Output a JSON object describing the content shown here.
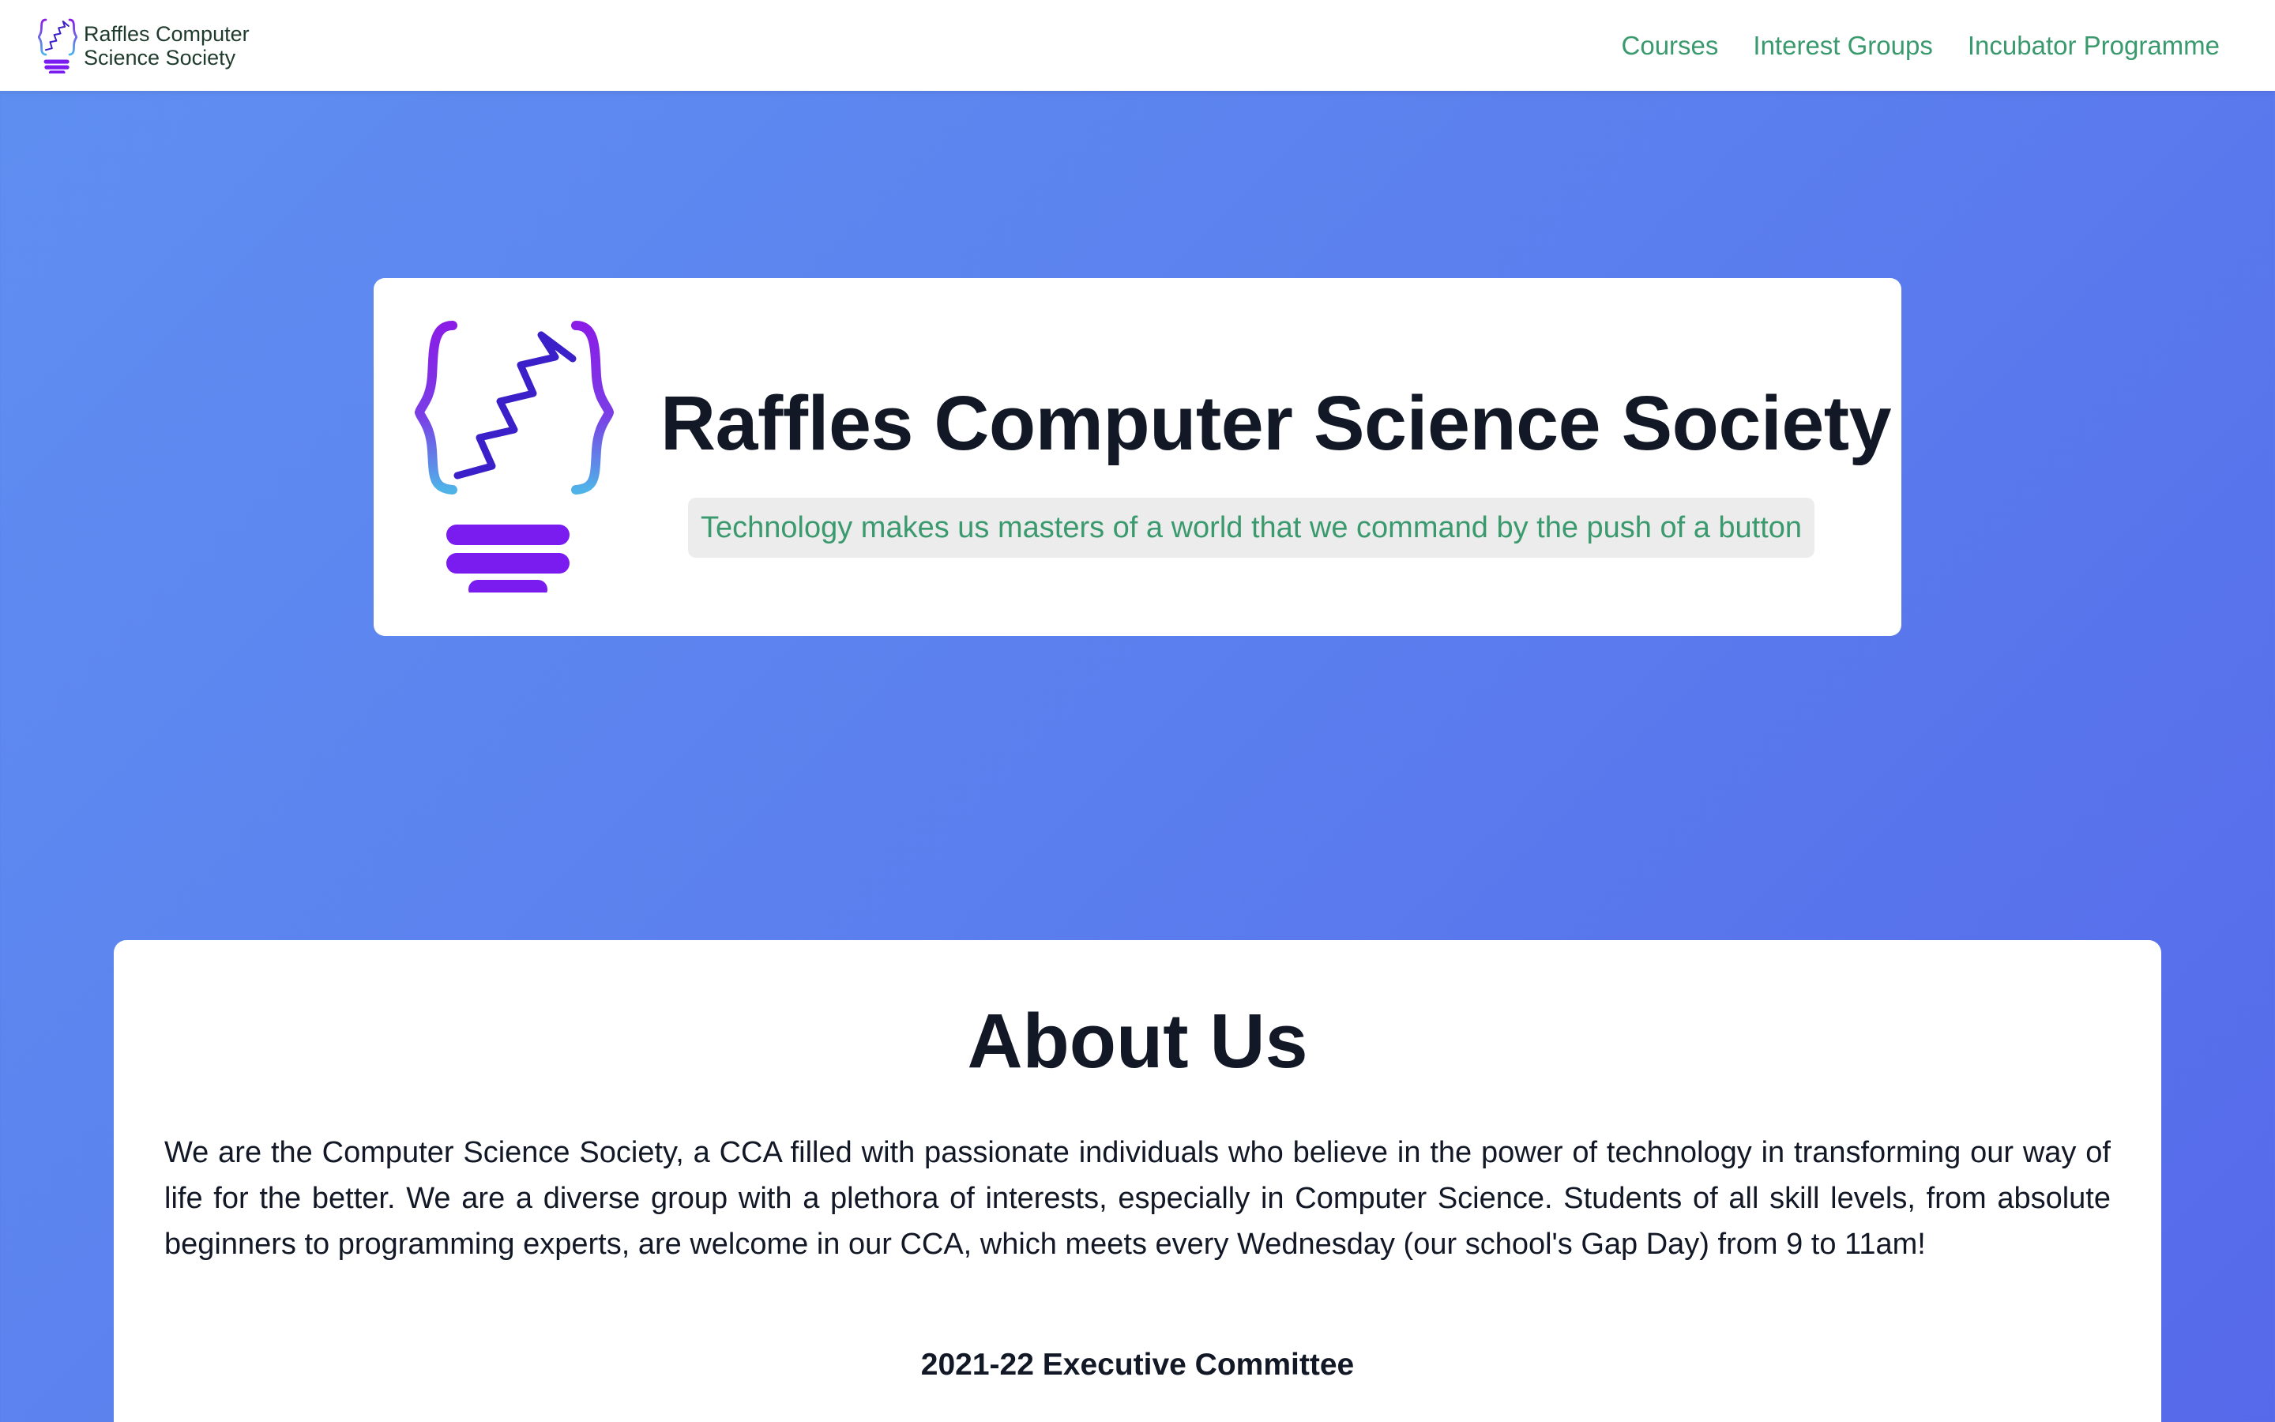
{
  "brand": {
    "line1": "Raffles Computer",
    "line2": "Science Society"
  },
  "nav": {
    "items": [
      {
        "label": "Courses"
      },
      {
        "label": "Interest Groups"
      },
      {
        "label": "Incubator Programme"
      }
    ]
  },
  "hero": {
    "title": "Raffles Computer Science Society",
    "tagline": "Technology makes us masters of a world that we command by the push of a button"
  },
  "about": {
    "title": "About Us",
    "paragraph": "We are the Computer Science Society, a CCA filled with passionate individuals who believe in the power of technology in transforming our way of life for the better. We are a diverse group with a plethora of interests, especially in Computer Science. Students of all skill levels, from absolute beginners to programming experts, are welcome in our CCA, which meets every Wednesday (our school's Gap Day) from 9 to 11am!",
    "committee_heading": "2021-22 Executive Committee"
  },
  "colors": {
    "accent_green": "#3a9a6e",
    "logo_purple": "#7a1cf0",
    "logo_blue": "#4fb3e8",
    "background_gradient_start": "#5f8ff1",
    "background_gradient_end": "#5669ea"
  },
  "icons": {
    "logo": "lightbulb-braces-logo-icon"
  }
}
